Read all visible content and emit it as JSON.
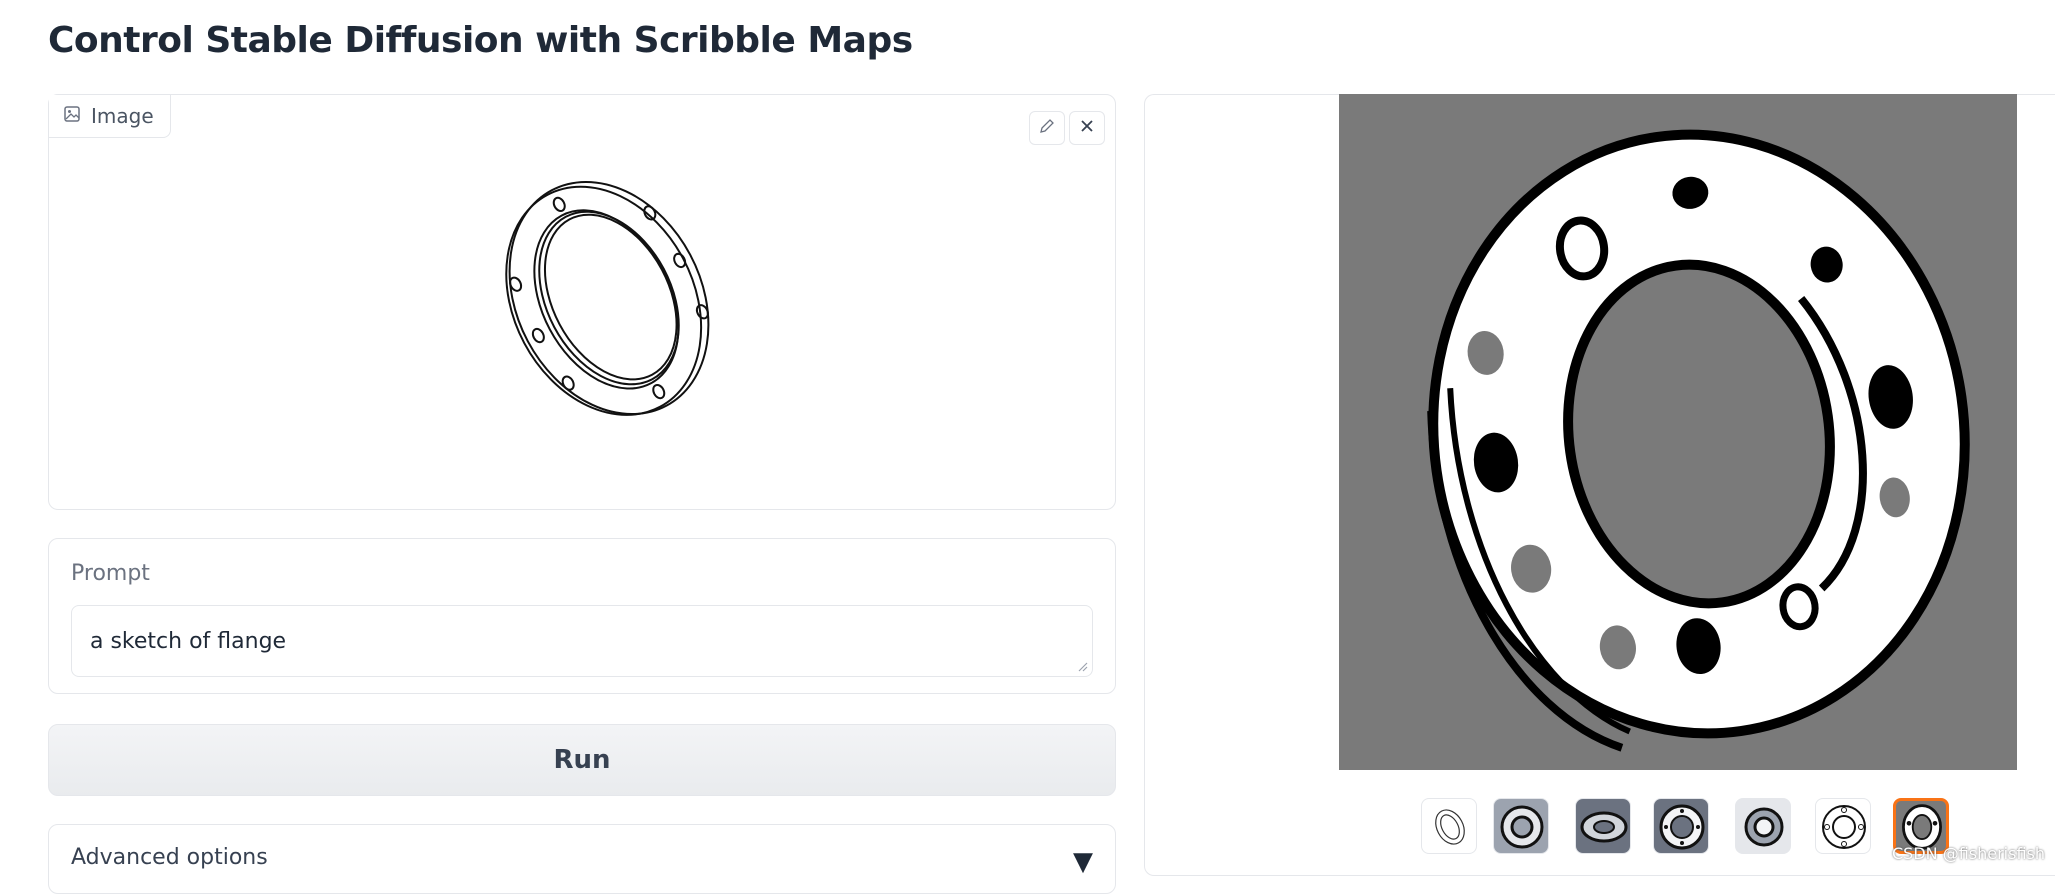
{
  "page": {
    "title": "Control Stable Diffusion with Scribble Maps"
  },
  "input_image": {
    "label": "Image",
    "label_icon": "image-icon",
    "edit_icon": "pencil-icon",
    "clear_icon": "close-icon"
  },
  "prompt": {
    "label": "Prompt",
    "value": "a sketch of flange"
  },
  "run_button": {
    "label": "Run"
  },
  "advanced": {
    "label": "Advanced options",
    "icon": "caret-down-icon",
    "caret": "▼"
  },
  "gallery": {
    "thumbnails_count": 7,
    "selected_index": 6
  },
  "watermark": "CSDN @fisherisfish",
  "colors": {
    "accent": "#f97316",
    "output_background": "#7a7a7a"
  }
}
